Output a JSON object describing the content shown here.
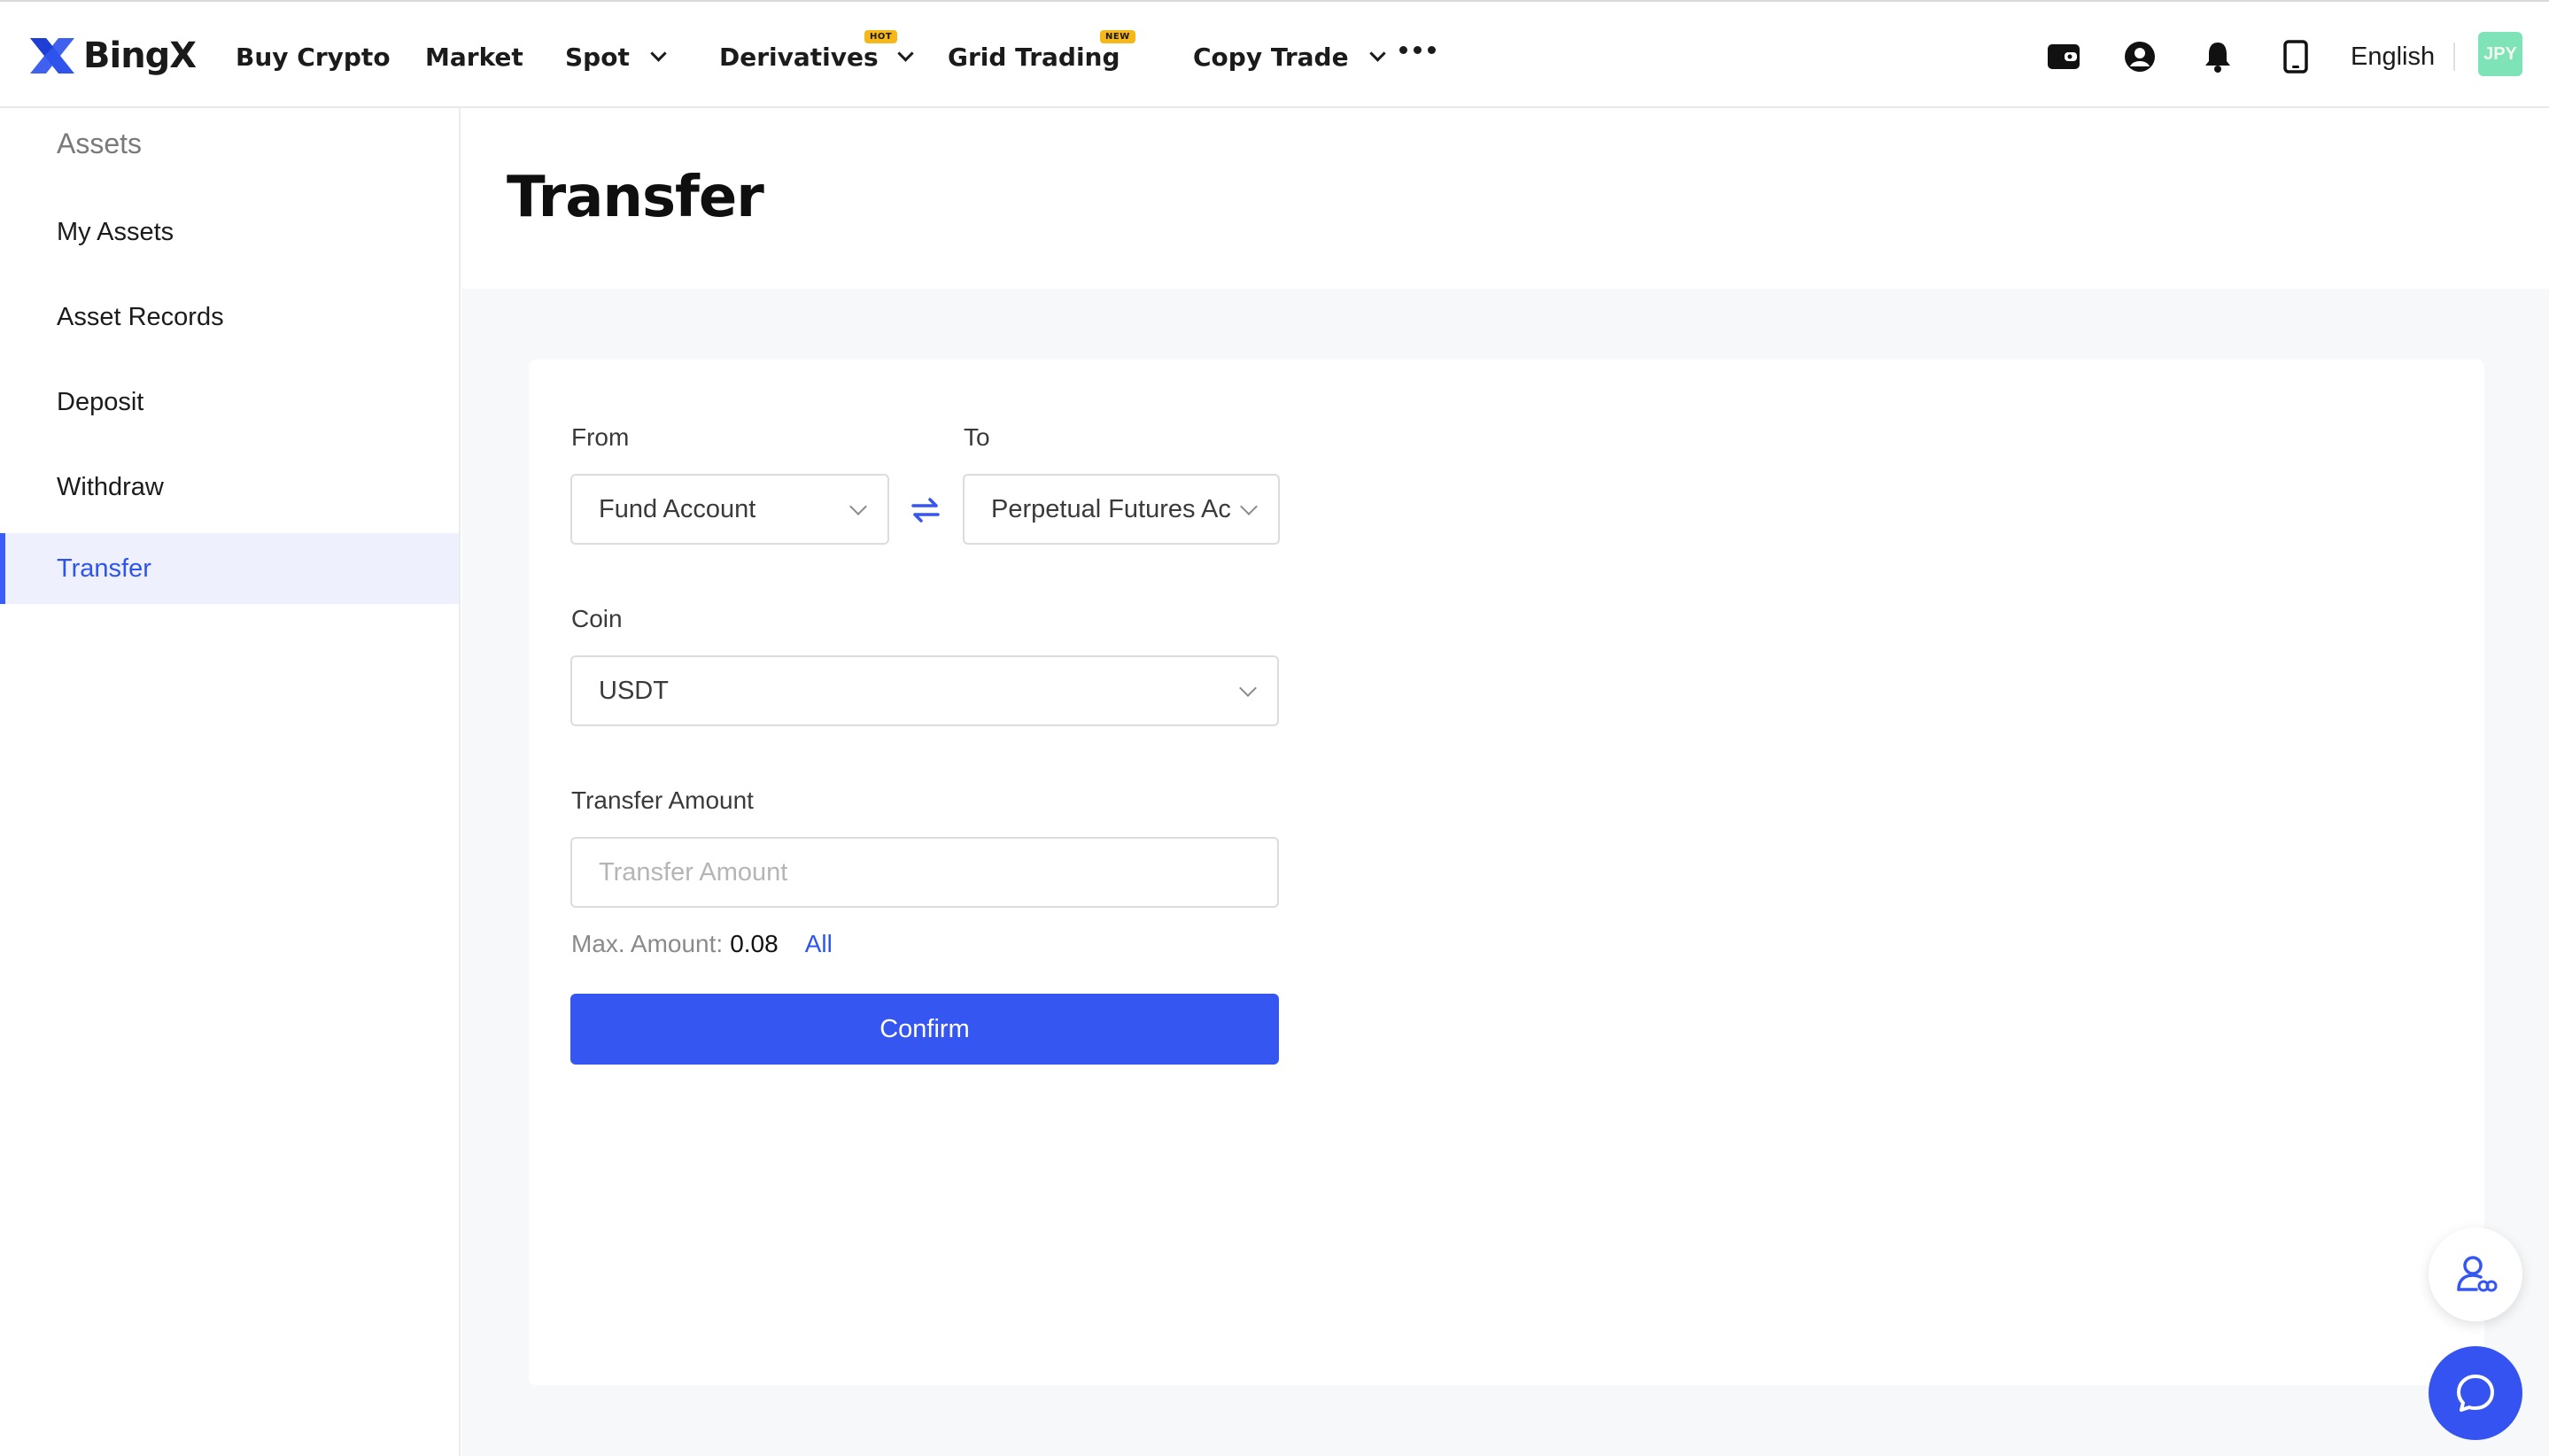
{
  "brand": {
    "name": "BingX",
    "accent": "#3656f2"
  },
  "nav": {
    "items": [
      {
        "label": "Buy Crypto",
        "dropdown": false
      },
      {
        "label": "Market",
        "dropdown": false
      },
      {
        "label": "Spot",
        "dropdown": true
      },
      {
        "label": "Derivatives",
        "dropdown": true,
        "badge": "HOT"
      },
      {
        "label": "Grid Trading",
        "dropdown": false,
        "badge": "NEW"
      },
      {
        "label": "Copy Trade",
        "dropdown": true
      }
    ],
    "more_icon": "more-dots-icon",
    "icons": [
      "wallet-icon",
      "user-icon",
      "bell-icon",
      "mobile-icon"
    ],
    "language": "English",
    "avatar_text": "JPY"
  },
  "sidebar": {
    "heading": "Assets",
    "items": [
      {
        "label": "My Assets",
        "active": false
      },
      {
        "label": "Asset Records",
        "active": false
      },
      {
        "label": "Deposit",
        "active": false
      },
      {
        "label": "Withdraw",
        "active": false
      },
      {
        "label": "Transfer",
        "active": true
      }
    ]
  },
  "page": {
    "title": "Transfer"
  },
  "form": {
    "from_label": "From",
    "from_value": "Fund Account",
    "to_label": "To",
    "to_value": "Perpetual Futures Account",
    "coin_label": "Coin",
    "coin_value": "USDT",
    "amount_label": "Transfer Amount",
    "amount_placeholder": "Transfer Amount",
    "max_label": "Max. Amount:",
    "max_value": "0.08",
    "all_label": "All",
    "confirm_label": "Confirm"
  },
  "floating": {
    "icons": [
      "support-agent-icon",
      "chat-bubble-icon"
    ]
  }
}
